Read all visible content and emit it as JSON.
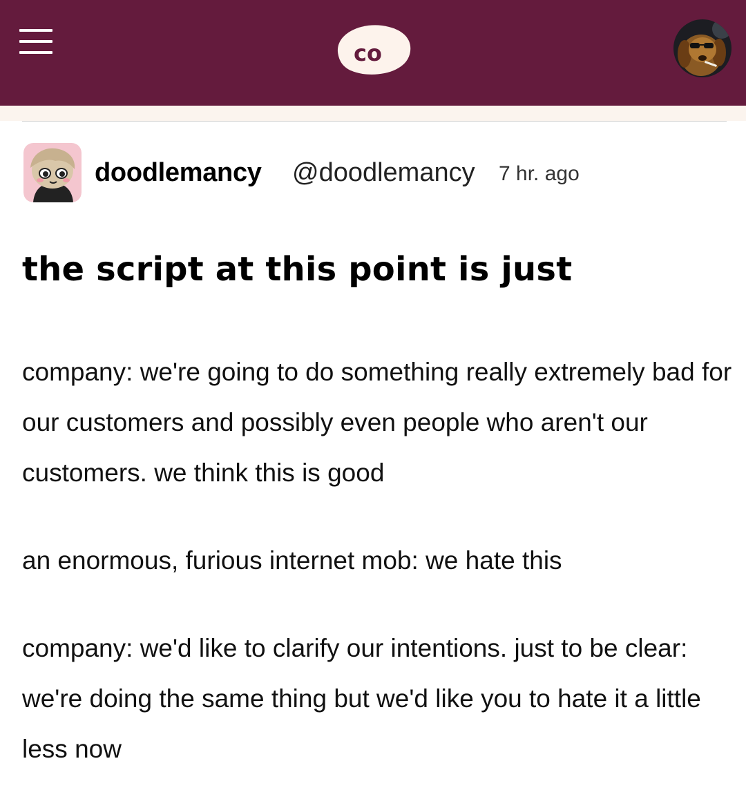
{
  "header": {
    "menu_icon": "hamburger-menu-icon",
    "logo_text": "co",
    "brand_color": "#641b3d",
    "profile_icon": "dog-avatar"
  },
  "post": {
    "author_name": "doodlemancy",
    "author_handle": "@doodlemancy",
    "timestamp": "7 hr. ago",
    "title": "the script at this point is just",
    "paragraphs": [
      "company: we're going to do something really extremely bad for our customers and possibly even people who aren't our customers. we think this is good",
      "an enormous, furious internet mob: we hate this",
      "company: we'd like to clarify our intentions. just to be clear: we're doing the same thing but we'd like you to hate it a little less now"
    ]
  }
}
